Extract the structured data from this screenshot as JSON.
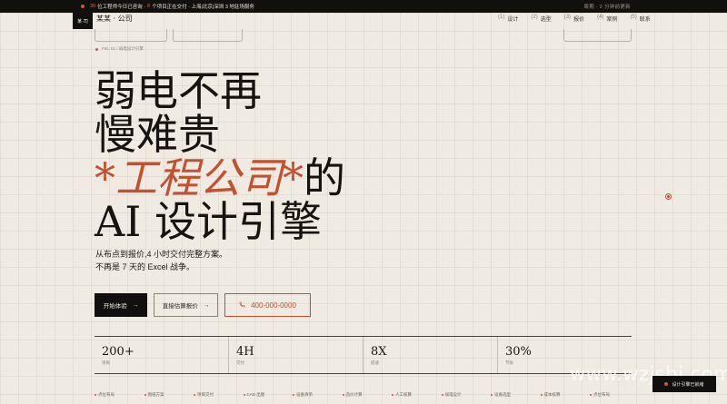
{
  "topbar": {
    "count": "30",
    "message1": "位工程师今日已咨询 ·",
    "count2": "8",
    "message2": "个项目正在交付 · 上海|北京|深圳 3 地驻场服务",
    "right_text": "周期 · 2 分钟前更新"
  },
  "nav": {
    "logo": "某·司",
    "brand": "某某 · 公司",
    "links": [
      {
        "index": "(1)",
        "label": "设计"
      },
      {
        "index": "(2)",
        "label": "选型"
      },
      {
        "index": "(3)",
        "label": "报价"
      },
      {
        "index": "(4)",
        "label": "案例"
      },
      {
        "index": "(5)",
        "label": "联系"
      }
    ]
  },
  "figure_label": "FIG. 01  /  弱电设计引擎",
  "headline": {
    "line1": "弱电不再",
    "line2": "慢难贵",
    "line3_accent": "*工程公司*",
    "line3_rest": "的",
    "line4": "AI 设计引擎"
  },
  "subtext": {
    "line1": "从布点到报价,4 小时交付完整方案。",
    "line2": "不再是 7 天的 Excel 战争。"
  },
  "buttons": {
    "primary": "开始体验",
    "secondary": "直接估算报价",
    "phone": "400-000-0000",
    "arrow": "→"
  },
  "stats": [
    {
      "value": "200+",
      "label": "项目"
    },
    {
      "value": "4H",
      "label": "交付"
    },
    {
      "value": "8X",
      "label": "提速"
    },
    {
      "value": "30%",
      "label": "节省"
    }
  ],
  "services": [
    "点位布局",
    "图纸方案",
    "项目交付",
    "CAD 出图",
    "设备清单",
    "造价计算",
    "人工核算",
    "弱电设计",
    "设备选型",
    "成本核算",
    "点位布局"
  ],
  "watermark": "www.wzjsbj.com",
  "chat_badge": "设计引擎已就绪",
  "colors": {
    "accent": "#c1512f",
    "background": "#efeae2",
    "dark": "#12100e"
  }
}
